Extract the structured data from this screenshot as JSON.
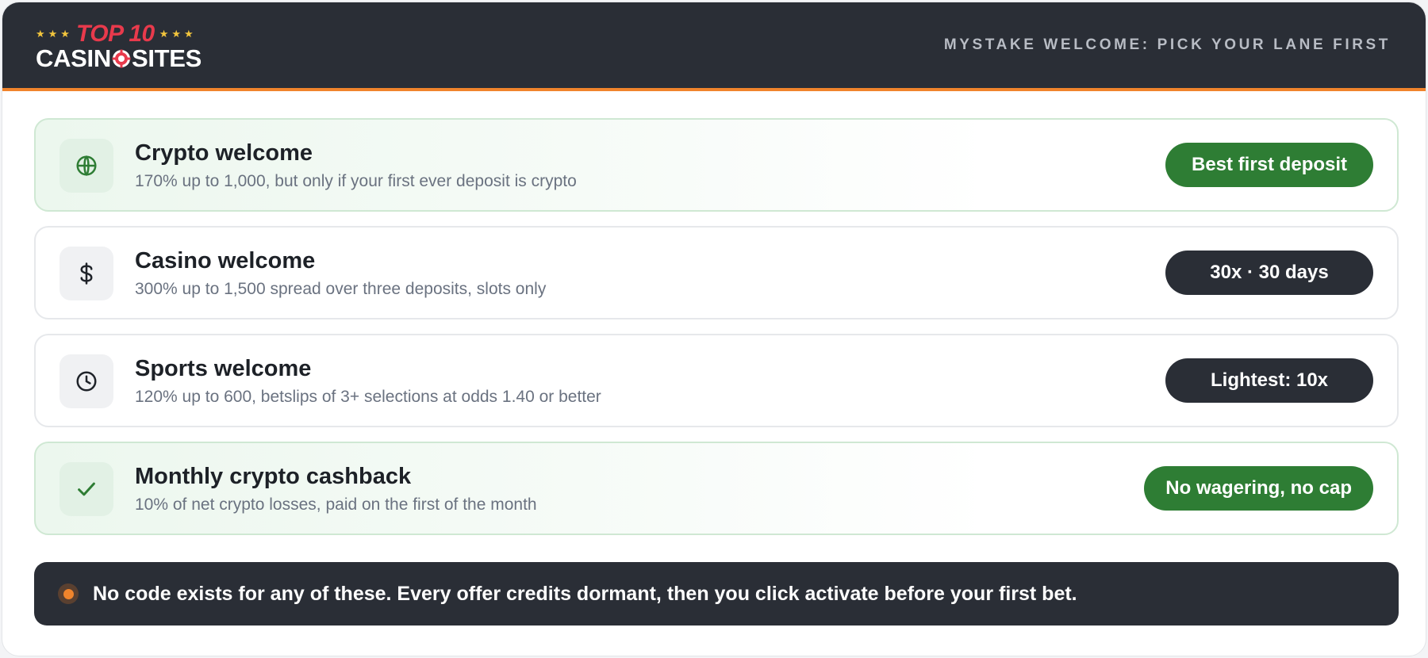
{
  "brand": {
    "logo_top": "TOP 10",
    "logo_bottom_left": "CASIN",
    "logo_bottom_right": "SITES",
    "stars_left": "★★★",
    "stars_right": "★★★"
  },
  "header": {
    "title": "MYSTAKE WELCOME: PICK YOUR LANE FIRST"
  },
  "offers": [
    {
      "title": "Crypto welcome",
      "description": "170% up to 1,000, but only if your first ever deposit is crypto",
      "badge": "Best first deposit",
      "icon": "globe-icon"
    },
    {
      "title": "Casino welcome",
      "description": "300% up to 1,500 spread over three deposits, slots only",
      "badge": "30x · 30 days",
      "icon": "currency-icon"
    },
    {
      "title": "Sports welcome",
      "description": "120% up to 600, betslips of 3+ selections at odds 1.40 or better",
      "badge": "Lightest: 10x",
      "icon": "clock-icon"
    },
    {
      "title": "Monthly crypto cashback",
      "description": "10% of net crypto losses, paid on the first of the month",
      "badge": "No wagering, no cap",
      "icon": "check-icon"
    }
  ],
  "notice": {
    "text": "No code exists for any of these. Every offer credits dormant, then you click activate before your first bet."
  },
  "colors": {
    "header_bg": "#2a2e36",
    "accent_orange": "#f0842c",
    "badge_green": "#2e7d34",
    "badge_dark": "#2a2e36",
    "logo_red": "#e83a4c",
    "star_yellow": "#f2c53d"
  }
}
